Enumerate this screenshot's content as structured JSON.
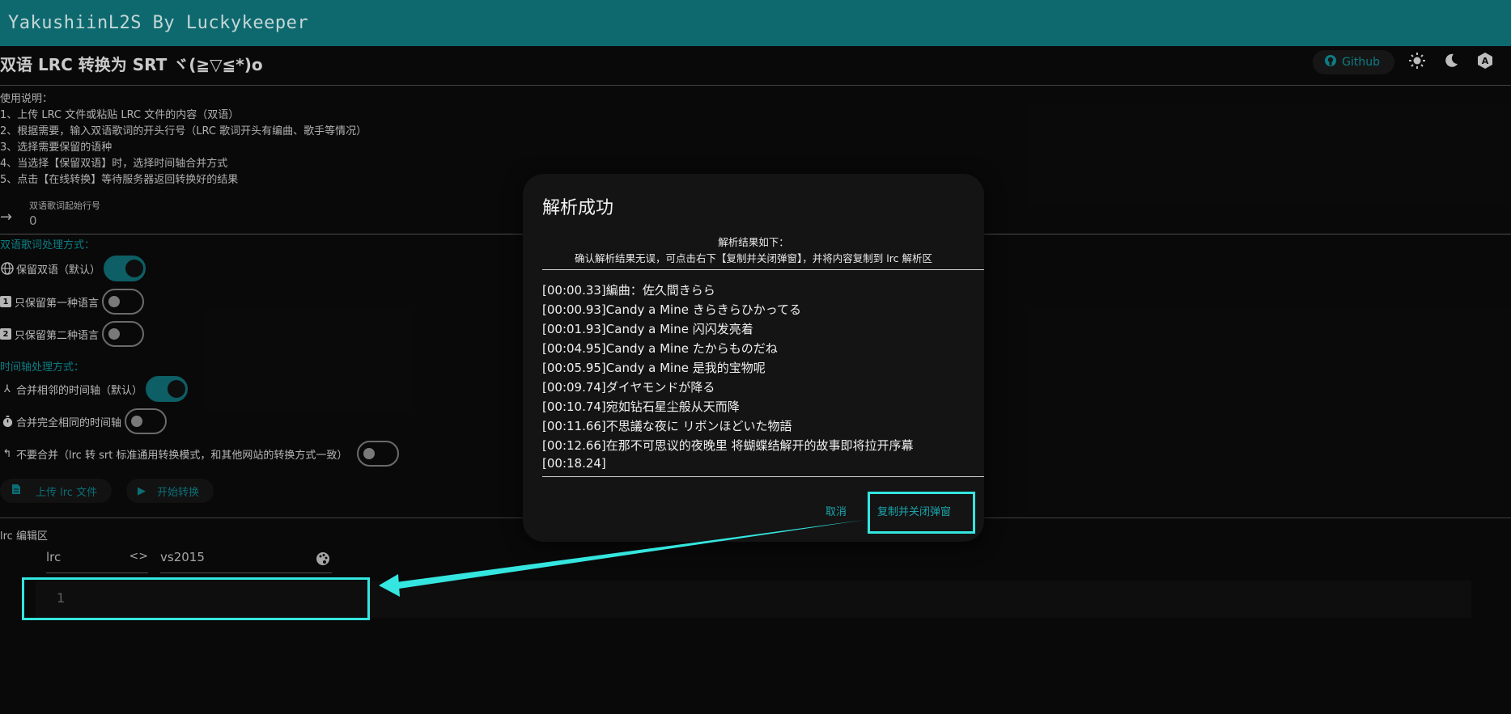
{
  "app": {
    "title": "YakushiinL2S By Luckykeeper"
  },
  "header": {
    "page_title": "双语 LRC 转换为 SRT ヾ(≧▽≦*)o",
    "github_label": "Github"
  },
  "instructions": {
    "heading": "使用说明：",
    "items": [
      "1、上传 LRC 文件或粘贴 LRC 文件的内容（双语）",
      "2、根据需要，输入双语歌词的开头行号（LRC 歌词开头有编曲、歌手等情况）",
      "3、选择需要保留的语种",
      "4、当选择【保留双语】时，选择时间轴合并方式",
      "5、点击【在线转换】等待服务器返回转换好的结果"
    ]
  },
  "start_line": {
    "label": "双语歌词起始行号",
    "value": "0"
  },
  "lyric_mode": {
    "label": "双语歌词处理方式：",
    "options": [
      {
        "label": "保留双语（默认）",
        "on": true
      },
      {
        "label": "只保留第一种语言",
        "on": false
      },
      {
        "label": "只保留第二种语言",
        "on": false
      }
    ]
  },
  "timeline_mode": {
    "label": "时间轴处理方式：",
    "options": [
      {
        "label": "合并相邻的时间轴（默认）",
        "on": true
      },
      {
        "label": "合并完全相同的时间轴",
        "on": false
      },
      {
        "label": "不要合并（lrc 转 srt 标准通用转换模式，和其他网站的转换方式一致）",
        "on": false
      }
    ]
  },
  "actions": {
    "upload_label": "上传 lrc 文件",
    "convert_label": "开始转换"
  },
  "editor": {
    "label": "lrc 编辑区",
    "language": "lrc",
    "theme": "vs2015",
    "line_number": "1"
  },
  "dialog": {
    "title": "解析成功",
    "desc_line1": "解析结果如下：",
    "desc_line2": "确认解析结果无误，可点击右下【复制并关闭弹窗】，并将内容复制到 lrc 解析区",
    "lines": [
      "[00:00.33]編曲：佐久間きらら",
      "[00:00.93]Candy a Mine きらきらひかってる",
      "[00:01.93]Candy a Mine 闪闪发亮着",
      "[00:04.95]Candy a Mine たからものだね",
      "[00:05.95]Candy a Mine 是我的宝物呢",
      "[00:09.74]ダイヤモンドが降る",
      "[00:10.74]宛如钻石星尘般从天而降",
      "[00:11.66]不思議な夜に リボンほどいた物語",
      "[00:12.66]在那不可思议的夜晚里 将蝴蝶结解开的故事即将拉开序幕",
      "[00:18.24]"
    ],
    "cancel_label": "取消",
    "confirm_label": "复制并关闭弹窗"
  },
  "colors": {
    "accent": "#0e8f97",
    "appbar": "#10787f",
    "annotation": "#34e6df"
  }
}
